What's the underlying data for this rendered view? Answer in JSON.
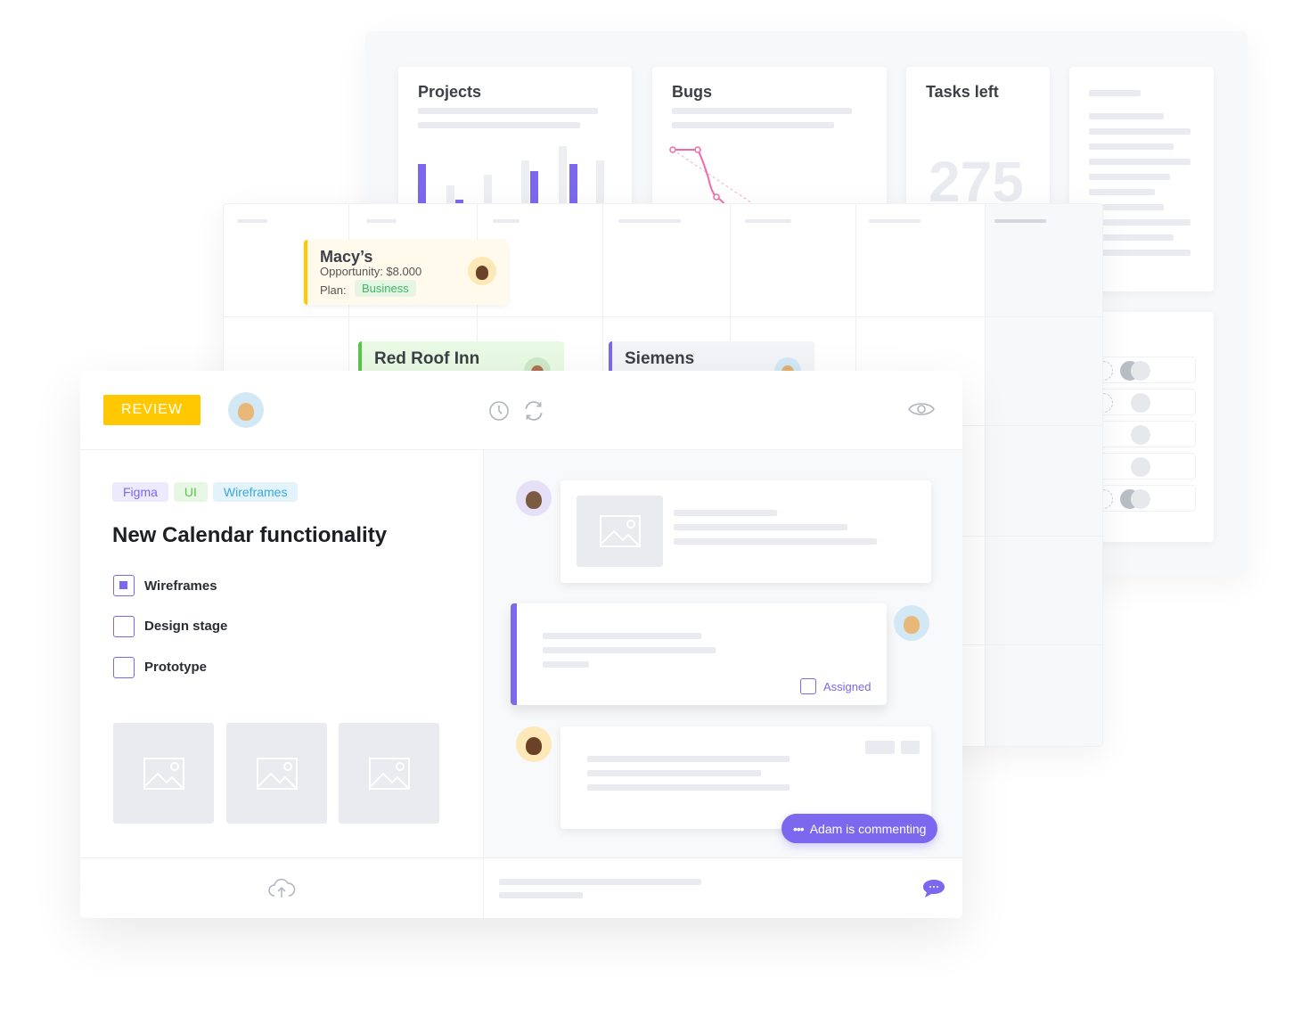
{
  "dashboard": {
    "projects": {
      "title": "Projects",
      "bars_purple": [
        0.55,
        0.05,
        0.45,
        0.55
      ],
      "bars_gray": [
        0.25,
        0.4,
        0.6,
        0.8,
        0.6
      ]
    },
    "bugs": {
      "title": "Bugs"
    },
    "tasks_left": {
      "title": "Tasks left",
      "value": "275"
    }
  },
  "board": {
    "cards": [
      {
        "name": "Macy’s",
        "opportunity": "Opportunity: $8.000",
        "plan_label": "Plan:",
        "plan": "Business",
        "accent": "#ffc800"
      },
      {
        "name": "Red Roof Inn",
        "accent": "#5bc44a"
      },
      {
        "name": "Siemens",
        "accent": "#7b68ee"
      }
    ]
  },
  "task": {
    "status": "REVIEW",
    "status_color": "#ffc800",
    "tags": [
      "Figma",
      "UI",
      "Wireframes"
    ],
    "title": "New Calendar functionality",
    "checklist": [
      {
        "label": "Wireframes",
        "checked": true
      },
      {
        "label": "Design stage",
        "checked": false
      },
      {
        "label": "Prototype",
        "checked": false
      }
    ],
    "assigned_label": "Assigned",
    "commenting": "Adam is commenting",
    "accent": "#7b68ee"
  }
}
